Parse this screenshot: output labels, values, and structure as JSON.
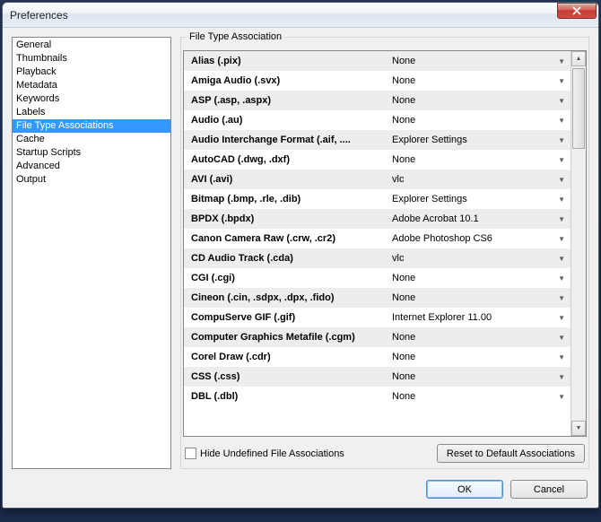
{
  "window": {
    "title": "Preferences"
  },
  "sidebar": {
    "selectedIndex": 6,
    "items": [
      {
        "label": "General"
      },
      {
        "label": "Thumbnails"
      },
      {
        "label": "Playback"
      },
      {
        "label": "Metadata"
      },
      {
        "label": "Keywords"
      },
      {
        "label": "Labels"
      },
      {
        "label": "File Type Associations"
      },
      {
        "label": "Cache"
      },
      {
        "label": "Startup Scripts"
      },
      {
        "label": "Advanced"
      },
      {
        "label": "Output"
      }
    ]
  },
  "panel": {
    "title": "File Type Association",
    "rows": [
      {
        "name": "Alias (.pix)",
        "app": "None"
      },
      {
        "name": "Amiga Audio (.svx)",
        "app": "None"
      },
      {
        "name": "ASP (.asp, .aspx)",
        "app": "None"
      },
      {
        "name": "Audio (.au)",
        "app": "None"
      },
      {
        "name": "Audio Interchange Format (.aif, ....",
        "app": "Explorer Settings"
      },
      {
        "name": "AutoCAD (.dwg, .dxf)",
        "app": "None"
      },
      {
        "name": "AVI (.avi)",
        "app": "vlc"
      },
      {
        "name": "Bitmap (.bmp, .rle, .dib)",
        "app": "Explorer Settings"
      },
      {
        "name": "BPDX (.bpdx)",
        "app": "Adobe Acrobat 10.1"
      },
      {
        "name": "Canon Camera Raw (.crw, .cr2)",
        "app": "Adobe Photoshop CS6"
      },
      {
        "name": "CD Audio Track (.cda)",
        "app": "vlc"
      },
      {
        "name": "CGI (.cgi)",
        "app": "None"
      },
      {
        "name": "Cineon (.cin, .sdpx, .dpx, .fido)",
        "app": "None"
      },
      {
        "name": "CompuServe GIF (.gif)",
        "app": "Internet Explorer 11.00"
      },
      {
        "name": "Computer Graphics Metafile (.cgm)",
        "app": "None"
      },
      {
        "name": "Corel Draw (.cdr)",
        "app": "None"
      },
      {
        "name": "CSS (.css)",
        "app": "None"
      },
      {
        "name": "DBL (.dbl)",
        "app": "None"
      }
    ],
    "checkboxLabel": "Hide Undefined File Associations",
    "resetLabel": "Reset to Default Associations"
  },
  "footer": {
    "ok": "OK",
    "cancel": "Cancel"
  }
}
